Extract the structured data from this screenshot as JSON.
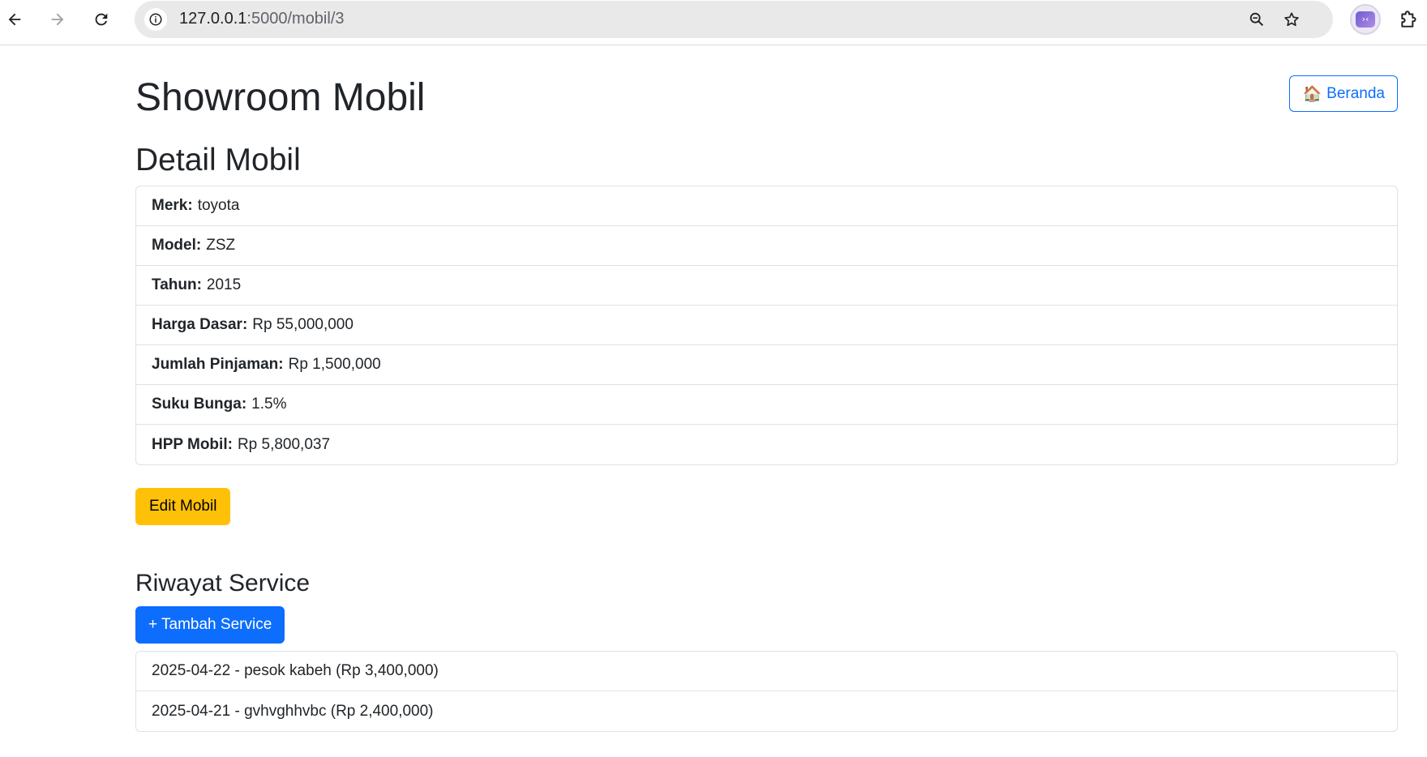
{
  "browser": {
    "url_host": "127.0.0.1",
    "url_path": ":5000/mobil/3",
    "profile_initials": "›‹"
  },
  "header": {
    "title": "Showroom Mobil",
    "home_icon": "house-icon",
    "home_label": "Beranda"
  },
  "detail": {
    "title": "Detail Mobil",
    "rows": [
      {
        "label": "Merk:",
        "value": "toyota"
      },
      {
        "label": "Model:",
        "value": "ZSZ"
      },
      {
        "label": "Tahun:",
        "value": "2015"
      },
      {
        "label": "Harga Dasar:",
        "value": "Rp 55,000,000"
      },
      {
        "label": "Jumlah Pinjaman:",
        "value": "Rp 1,500,000"
      },
      {
        "label": "Suku Bunga:",
        "value": "1.5%"
      },
      {
        "label": "HPP Mobil:",
        "value": "Rp 5,800,037"
      }
    ],
    "edit_label": "Edit Mobil"
  },
  "service": {
    "title": "Riwayat Service",
    "add_label": "+ Tambah Service",
    "items": [
      "2025-04-22 - pesok kabeh (Rp 3,400,000)",
      "2025-04-21 - gvhvghhvbc (Rp 2,400,000)"
    ]
  }
}
